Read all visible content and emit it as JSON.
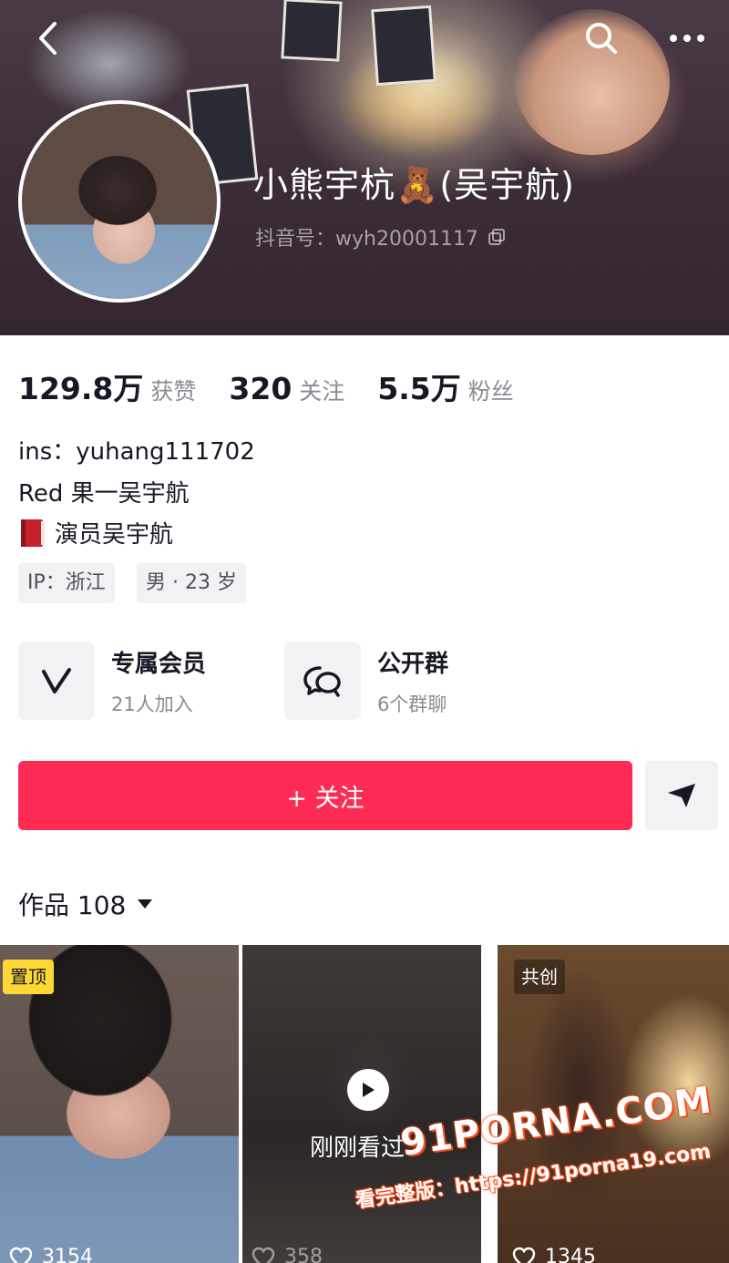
{
  "header": {
    "nickname": "小熊宇杭🧸(吴宇航)",
    "douyin_id": "抖音号：wyh20001117",
    "background_color": "#3b2c38"
  },
  "stats": {
    "likes_value": "129.8万",
    "likes_label": "获赞",
    "following_value": "320",
    "following_label": "关注",
    "followers_value": "5.5万",
    "followers_label": "粉丝"
  },
  "bio": {
    "line1": "ins：yuhang111702",
    "line2": "Red 果一吴宇航",
    "line3": "演员吴宇航",
    "line3_icon": "red-book-icon"
  },
  "tags": [
    "IP：浙江",
    "男 · 23 岁"
  ],
  "features": [
    {
      "title": "专属会员",
      "subtitle": "21人加入",
      "icon": "v-logo-icon"
    },
    {
      "title": "公开群",
      "subtitle": "6个群聊",
      "icon": "chat-bubbles-icon"
    }
  ],
  "actions": {
    "follow_label": "+ 关注",
    "follow_color": "#fe2c55"
  },
  "works": {
    "label": "作品 108",
    "items": [
      {
        "badge": "置顶",
        "likes": "3154"
      },
      {
        "overlay": "刚刚看过",
        "likes": "358"
      },
      {
        "badge": "共创",
        "likes": "1345"
      }
    ]
  },
  "watermark": {
    "logo": "91PORNA.COM",
    "text": "看完整版：https://91porna19.com"
  }
}
